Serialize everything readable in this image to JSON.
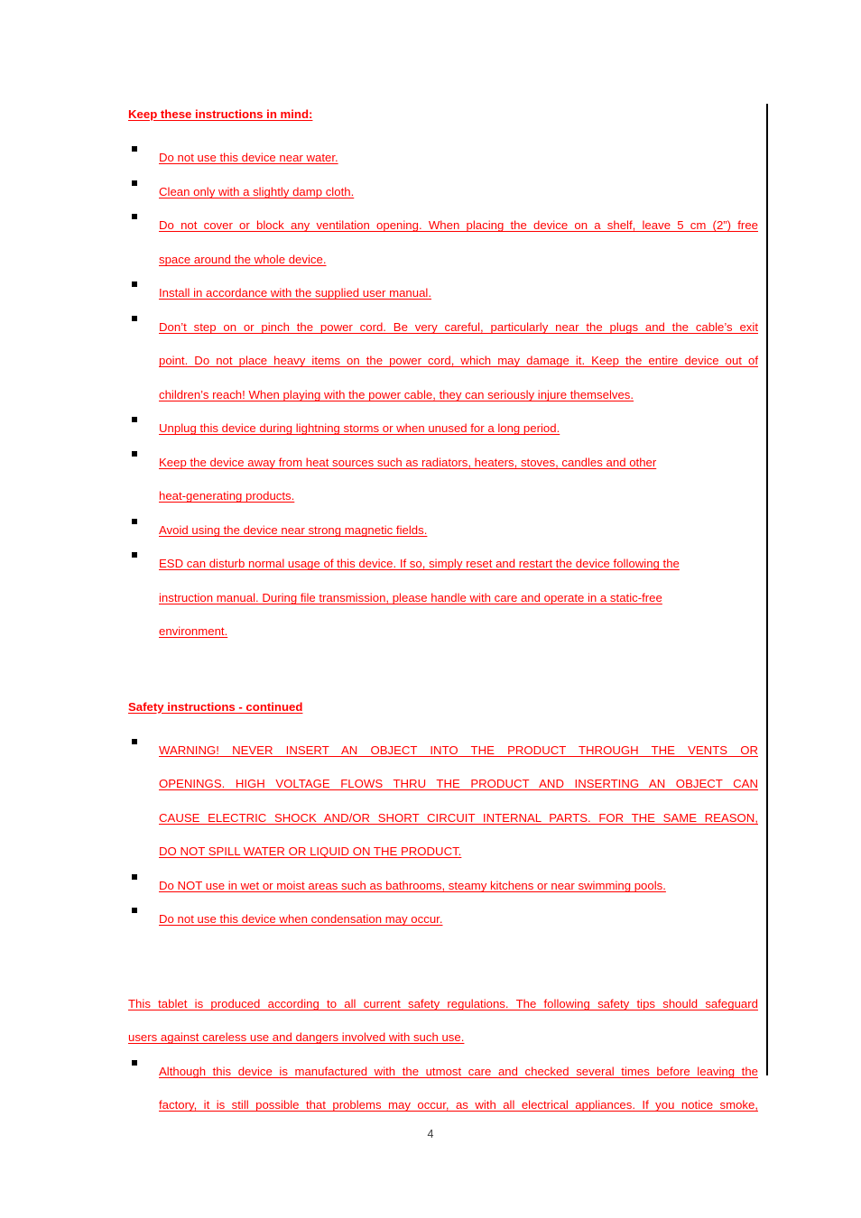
{
  "document": {
    "page_number": "4",
    "text_color": "#FF0000",
    "bullet_color": "#000000",
    "change_bar_color": "#000000"
  },
  "section1": {
    "heading": "Keep these instructions in mind:",
    "items": [
      {
        "text": "Do not use this device near water."
      },
      {
        "text": "Clean only with a slightly damp cloth."
      },
      {
        "line1": "Do not cover or block any ventilation opening. When placing the device on a shelf, leave 5 cm (2”) free",
        "line2": "space around the whole device."
      },
      {
        "text": "Install in accordance with the supplied user manual."
      },
      {
        "line1": "Don’t step on or pinch the power cord. Be very careful, particularly near the plugs and the cable’s exit",
        "line2": "point. Do not place heavy items on the power cord, which may damage it. Keep the entire device out of",
        "line3": "children’s reach! When playing with the power cable, they can seriously injure themselves."
      },
      {
        "text": "Unplug this device during lightning storms or when unused for a long period."
      },
      {
        "line1": "Keep the device away from heat sources such as radiators, heaters, stoves, candles and other",
        "line2": "heat-generating products."
      },
      {
        "text": "Avoid using the device near strong magnetic fields."
      },
      {
        "line1": "ESD can disturb normal usage of this device. If so, simply reset and restart the device following the",
        "line2": "instruction manual. During file transmission, please handle with care and operate in a static-free",
        "line3": "environment."
      }
    ]
  },
  "section2": {
    "heading": "Safety instructions - continued",
    "warning": {
      "line1": "WARNING! NEVER INSERT AN OBJECT INTO THE PRODUCT THROUGH THE VENTS OR",
      "line2": "OPENINGS. HIGH VOLTAGE FLOWS THRU THE PRODUCT AND INSERTING AN OBJECT CAN",
      "line3": "CAUSE ELECTRIC SHOCK AND/OR SHORT CIRCUIT INTERNAL PARTS. FOR THE SAME REASON,",
      "line4": "DO NOT SPILL WATER OR LIQUID ON THE PRODUCT."
    },
    "items": [
      {
        "text": "Do NOT use in wet or moist areas such as bathrooms, steamy kitchens or near swimming pools."
      },
      {
        "text": "Do not use this device when condensation may occur."
      }
    ]
  },
  "section3": {
    "paragraph": {
      "line1": "This tablet is produced according to all current safety regulations. The following safety tips should safeguard",
      "line2": "users against careless use and dangers involved with such use."
    },
    "items": [
      {
        "line1": "Although this device is manufactured with the utmost care and checked several times before leaving the",
        "line2": "factory, it is still possible that problems may occur, as with all electrical appliances. If you notice smoke,"
      }
    ]
  }
}
